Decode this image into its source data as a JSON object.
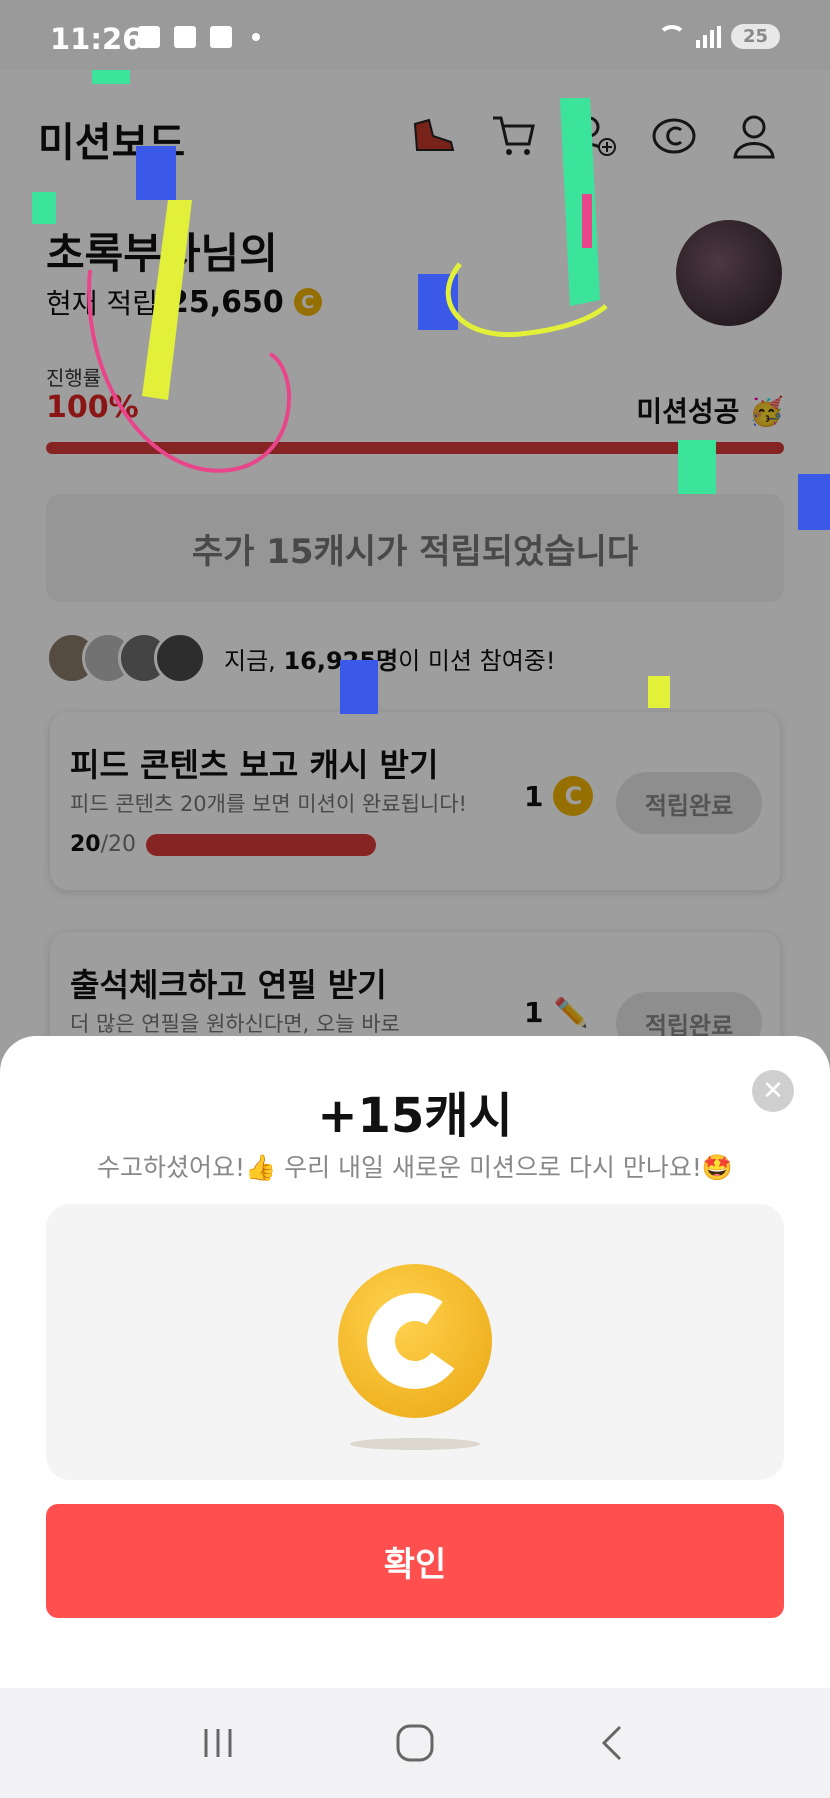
{
  "status_bar": {
    "time": "11:26",
    "battery": "25"
  },
  "header": {
    "title": "미션보드"
  },
  "user": {
    "name": "초록부자님의",
    "balance_label": "현재 적립",
    "balance_value": "25,650",
    "coin_symbol": "C"
  },
  "progress": {
    "label": "진행률",
    "value": "100%",
    "fraction": 1.0,
    "success_label": "미션성공 🥳"
  },
  "bonus_message": "추가 15캐시가 적립되었습니다",
  "participants": {
    "prefix": "지금,",
    "count": "16,925명",
    "suffix": "이 미션 참여중!"
  },
  "missions": [
    {
      "title": "피드 콘텐츠 보고 캐시 받기",
      "desc": "피드 콘텐츠 20개를 보면 미션이 완료됩니다!",
      "reward": "1",
      "reward_icon": "C",
      "button": "적립완료",
      "count_done": "20",
      "count_total": "/20"
    },
    {
      "title": "출석체크하고 연필 받기",
      "desc": "더 많은 연필을 원하신다면, 오늘 바로",
      "reward": "1",
      "reward_icon": "✏️",
      "button": "적립완료"
    }
  ],
  "sheet": {
    "title": "+15캐시",
    "subtitle": "수고하셨어요!👍 우리 내일 새로운 미션으로 다시 만나요!🤩",
    "close": "✕",
    "confirm": "확인"
  },
  "colors": {
    "accent": "#ff4f4f",
    "progress": "#d83b3b",
    "coin": "#f0b400"
  }
}
